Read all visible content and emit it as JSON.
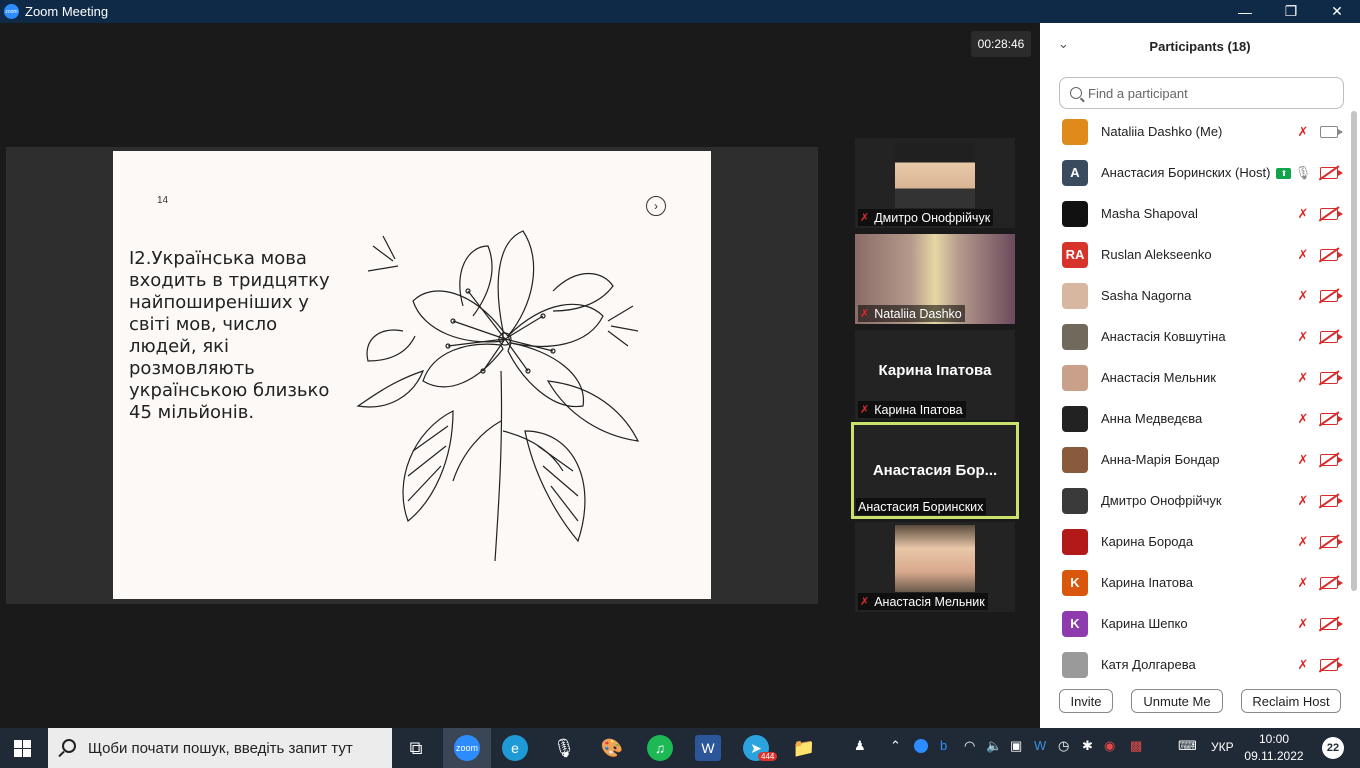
{
  "window": {
    "title": "Zoom Meeting",
    "minimize": "—",
    "maximize": "❐",
    "close": "✕"
  },
  "meeting": {
    "timer": "00:28:46",
    "slide": {
      "number": "14",
      "text": "І2.Українська мова входить в тридцятку найпоширеніших у світі мов, число людей, які розмовляють українською близько 45 мільйонів."
    },
    "tiles": [
      {
        "name": "Дмитро Онофрійчук",
        "muted": true,
        "video": "photo"
      },
      {
        "name": "Nataliia Dashko",
        "muted": true,
        "video": "photo"
      },
      {
        "name": "Карина Іпатова",
        "display_name": "Карина Іпатова",
        "muted": true,
        "video": "none"
      },
      {
        "name": "Анастасия Боринских",
        "display_name": "Анастасия Бор...",
        "muted": false,
        "video": "none",
        "active": true
      },
      {
        "name": "Анастасія Мельник",
        "muted": true,
        "video": "photo"
      }
    ]
  },
  "participants": {
    "title": "Participants (18)",
    "search_placeholder": "Find a participant",
    "list": [
      {
        "name": "Nataliia Dashko (Me)",
        "avatar": "",
        "color": "#e08a1c",
        "mic": "muted",
        "cam": "on"
      },
      {
        "name": "Анастасия Боринских (Host)",
        "avatar": "A",
        "color": "#3b4b5f",
        "mic": "on",
        "cam": "off",
        "sharing": true
      },
      {
        "name": "Masha Shapoval",
        "avatar": "",
        "color": "#111111",
        "mic": "muted",
        "cam": "off"
      },
      {
        "name": "Ruslan Alekseenko",
        "avatar": "RA",
        "color": "#d6332b",
        "mic": "muted",
        "cam": "off"
      },
      {
        "name": "Sasha Nagorna",
        "avatar": "",
        "color": "#d8b7a0",
        "mic": "muted",
        "cam": "off"
      },
      {
        "name": "Анастасія Ковшутіна",
        "avatar": "",
        "color": "#6f6a5c",
        "mic": "muted",
        "cam": "off"
      },
      {
        "name": "Анастасія Мельник",
        "avatar": "",
        "color": "#c9a08a",
        "mic": "muted",
        "cam": "off"
      },
      {
        "name": "Анна Медведєва",
        "avatar": "",
        "color": "#222222",
        "mic": "muted",
        "cam": "off"
      },
      {
        "name": "Анна-Марія Бондар",
        "avatar": "",
        "color": "#8a5a3c",
        "mic": "muted",
        "cam": "off"
      },
      {
        "name": "Дмитро Онофрійчук",
        "avatar": "",
        "color": "#3a3a3a",
        "mic": "muted",
        "cam": "off"
      },
      {
        "name": "Карина Борода",
        "avatar": "",
        "color": "#b21a1a",
        "mic": "muted",
        "cam": "off"
      },
      {
        "name": "Карина Іпатова",
        "avatar": "K",
        "color": "#d9560c",
        "mic": "muted",
        "cam": "off"
      },
      {
        "name": "Карина Шепко",
        "avatar": "K",
        "color": "#8e3bb0",
        "mic": "muted",
        "cam": "off"
      },
      {
        "name": "Катя Долгарева",
        "avatar": "",
        "color": "#9a9a9a",
        "mic": "muted",
        "cam": "off"
      }
    ],
    "buttons": {
      "invite": "Invite",
      "unmute": "Unmute Me",
      "reclaim": "Reclaim Host"
    }
  },
  "taskbar": {
    "search_placeholder": "Щоби почати пошук, введіть запит тут",
    "apps": [
      {
        "name": "task-view",
        "glyph": "⧉"
      },
      {
        "name": "zoom",
        "glyph": "zoom",
        "color": "#2d8cff",
        "active": true
      },
      {
        "name": "edge",
        "glyph": "e",
        "color": "#1e9bd7"
      },
      {
        "name": "microphone",
        "glyph": "🎙"
      },
      {
        "name": "paint",
        "glyph": "🎨"
      },
      {
        "name": "spotify",
        "glyph": "♫",
        "color": "#1db954"
      },
      {
        "name": "word",
        "glyph": "W",
        "color": "#2b579a"
      },
      {
        "name": "telegram",
        "glyph": "➤",
        "color": "#2aa3df",
        "badge": "444"
      },
      {
        "name": "explorer",
        "glyph": "📁"
      }
    ],
    "language": "УКР",
    "time": "10:00",
    "date": "09.11.2022",
    "notifications": "22"
  }
}
